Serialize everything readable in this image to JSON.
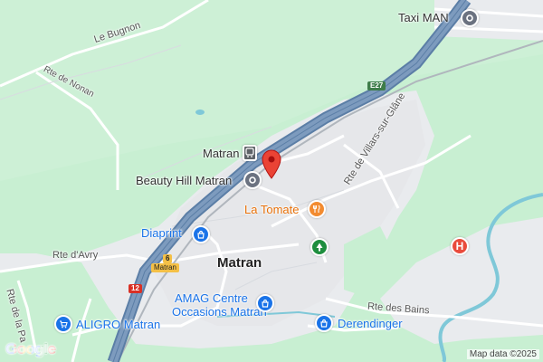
{
  "map": {
    "labels": {
      "le_bugnon": "Le Bugnon",
      "rte_de_nonan": "Rte de Nonan",
      "taxi_man": "Taxi MAN",
      "e27": "E27",
      "matran_station": "Matran",
      "beauty_hill": "Beauty Hill Matran",
      "la_tomate": "La Tomate",
      "rte_de_villars": "Rte de Villars-sur-Glâne",
      "diaprint": "Diaprint",
      "rte_davry": "Rte d'Avry",
      "route_6": "6",
      "matran_sign": "Matran",
      "town": "Matran",
      "route_12": "12",
      "amag_line1": "AMAG Centre",
      "amag_line2": "Occasions Matran",
      "rte_des_bains": "Rte des Bains",
      "derendinger": "Derendinger",
      "aligro": "ALIGRO Matran",
      "rte_de_la_pa": "Rte de la Pa"
    },
    "icons": [
      "train-station-icon",
      "cafe-pin-icon",
      "restaurant-pin-icon",
      "shopping-pin-icon",
      "park-pin-icon",
      "hospital-pin-icon",
      "location-marker-icon"
    ],
    "colors": {
      "green_area": "#c8efd2",
      "urban_area": "#e9ebee",
      "highway": "#6b8cb0",
      "water": "#7fc8d8",
      "poi_blue": "#1a73e8",
      "restaurant_orange": "#f28b30",
      "hospital_red": "#e94b3c",
      "park_green": "#1e8e3e",
      "marker_red": "#ea4335"
    }
  },
  "footer": {
    "logo": "Google",
    "attribution": "Map data ©2025"
  }
}
